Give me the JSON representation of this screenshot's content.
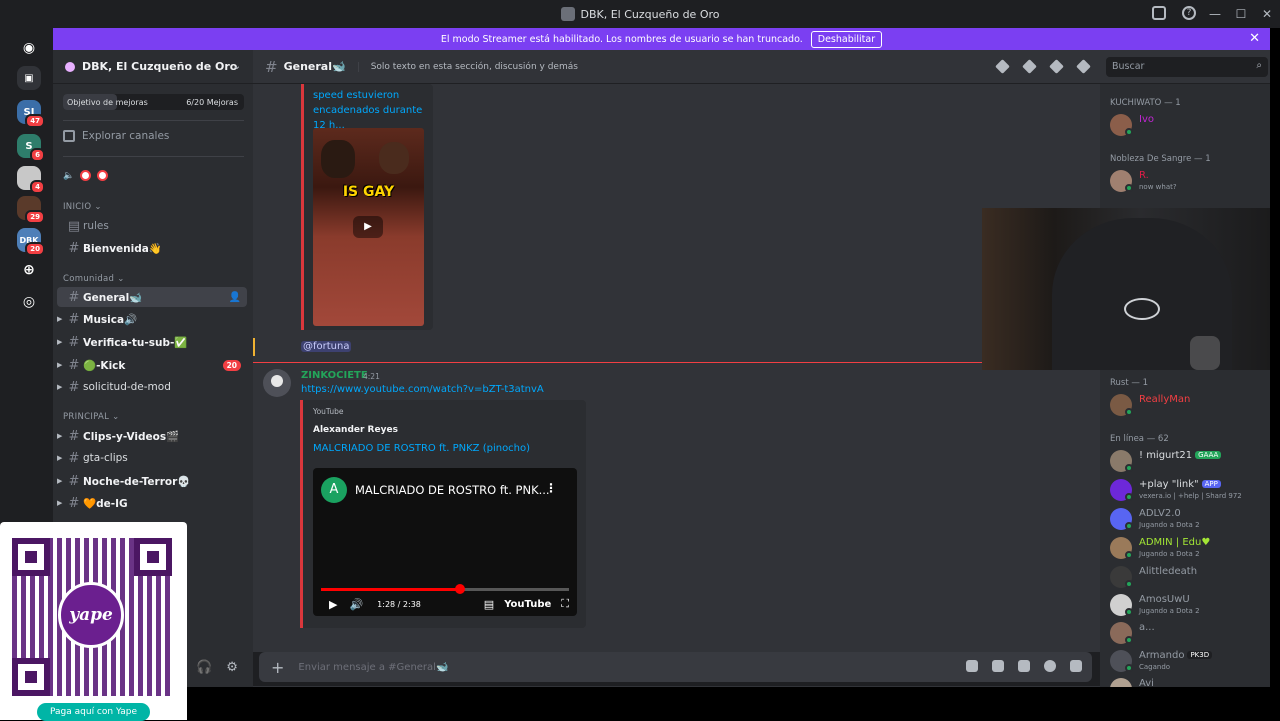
{
  "window": {
    "title": "DBK, El Cuzqueño de Oro",
    "controls": [
      "—",
      "☐",
      "✕"
    ]
  },
  "banner": {
    "text": "El modo Streamer está habilitado. Los nombres de usuario se han truncado.",
    "button_label": "Deshabilitar"
  },
  "guilds": [
    {
      "label": "",
      "badge": "",
      "color": "#1e1f22"
    },
    {
      "label": "",
      "badge": "",
      "color": "#313338"
    },
    {
      "label": "SJ",
      "badge": "47",
      "color": "#3b6ea8"
    },
    {
      "label": "S",
      "badge": "6",
      "color": "#2e7d6b"
    },
    {
      "label": "",
      "badge": "4",
      "color": "#c8c8c8"
    },
    {
      "label": "",
      "badge": "29",
      "color": "#5a3a2a"
    },
    {
      "label": "DBK",
      "badge": "20",
      "color": "#4e7fb8"
    }
  ],
  "server": {
    "name": "DBK, El Cuzqueño de Oro",
    "goal_label": "Objetivo de mejoras",
    "goal_count": "6/20 Mejoras",
    "goal_progress": 0.3,
    "explore": "Explorar canales"
  },
  "categories": {
    "inicio": "INICIO",
    "comunidad": "Comunidad",
    "principal": "PRINCIPAL"
  },
  "channels": {
    "rules": "rules",
    "bienvenida": "Bienvenida👋",
    "general": "General🐋",
    "musica": "Musica🔊",
    "verifica": "Verifica-tu-sub-✅",
    "kick": "🟢-Kick",
    "kick_count": "20",
    "solicitud": "solicitud-de-mod",
    "clips": "Clips-y-Videos🎬",
    "gta": "gta-clips",
    "noche": "Noche-de-Terror💀",
    "ig": "🧡de-IG"
  },
  "qr": {
    "logo_text": "yape",
    "pay_label": "Paga aquí con Yape"
  },
  "chat_header": {
    "channel": "General🐋",
    "topic": "Solo texto en esta sección, discusión y demás",
    "search_placeholder": "Buscar"
  },
  "messages": {
    "embed1_title": "speed estuvieron encadenados durante 12 h...",
    "thumb_text": "IS GAY",
    "mention": "@fortuna",
    "msg2_user": "ZINKOCIETE",
    "msg2_time": "4:21",
    "msg2_link": "https://www.youtube.com/watch?v=bZT-t3atnvA",
    "embed2_provider": "YouTube",
    "embed2_author": "Alexander Reyes",
    "embed2_title": "MALCRIADO DE ROSTRO ft. PNKZ (pinocho)",
    "video_channel_initial": "A",
    "video_title": "MALCRIADO DE ROSTRO ft. PNK...",
    "video_time": "1:28 / 2:38",
    "video_logo": "YouTube",
    "video_progress": 0.56
  },
  "composer": {
    "placeholder": "Enviar mensaje a #General🐋"
  },
  "members": {
    "groups": {
      "kuchiwato": "KUCHIWATO — 1",
      "nobleza": "Nobleza De Sangre — 1",
      "rust": "Rust — 1",
      "online": "En línea — 62"
    },
    "list": {
      "m_kuchi": {
        "name": "Ivo",
        "sub": "",
        "color": "#c026d3",
        "avatar": "#8b5e4a"
      },
      "m_nobleza": {
        "name": "R.",
        "sub": "now what?",
        "color": "#e11d48",
        "avatar": "#a08070"
      },
      "m_rust": {
        "name": "ReallyMan",
        "sub": "",
        "color": "#f23f43",
        "avatar": "#7a5a44"
      },
      "m1": {
        "name": "! migurt21",
        "tag": "GAAA",
        "tag_color": "#23a55a",
        "sub": "",
        "color": "#dbdee1",
        "avatar": "#8a7a6a"
      },
      "m2": {
        "name": "+play \"link\"",
        "tag": "APP",
        "tag_color": "#5865f2",
        "sub": "vexera.io | +help | Shard 972",
        "color": "#dbdee1",
        "avatar": "#6d28d9"
      },
      "m3": {
        "name": "ADLV2.0",
        "sub": "Jugando a Dota 2",
        "color": "#949ba4",
        "avatar": "#5865f2"
      },
      "m4": {
        "name": "ADMIN | Edu♥",
        "sub": "Jugando a Dota 2",
        "color": "#a3e635",
        "avatar": "#9a7a5a"
      },
      "m5": {
        "name": "Alittledeath",
        "sub": "",
        "color": "#949ba4",
        "avatar": "#3a3a3a"
      },
      "m6": {
        "name": "AmosUwU",
        "sub": "Jugando a Dota 2",
        "color": "#949ba4",
        "avatar": "#d0d0d0"
      },
      "m7": {
        "name": "a...",
        "sub": "",
        "color": "#949ba4",
        "avatar": "#8a6a5a"
      },
      "m8": {
        "name": "Armando",
        "tag": "PK3D",
        "tag_color": "#1e1f22",
        "sub": "Cagando",
        "color": "#949ba4",
        "avatar": "#4e5058"
      },
      "m9": {
        "name": "Avi",
        "sub": "",
        "color": "#949ba4",
        "avatar": "#b0a090"
      }
    }
  }
}
